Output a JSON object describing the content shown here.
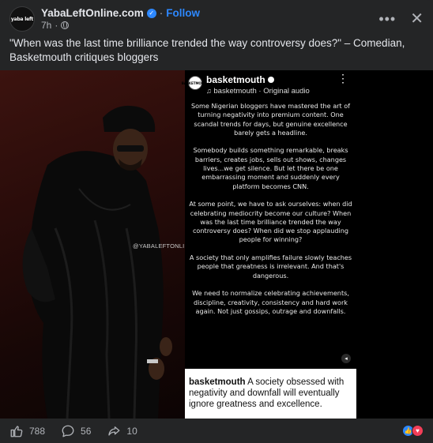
{
  "header": {
    "avatar_text": "yaba left",
    "page_name": "YabaLeftOnline.com",
    "separator": "·",
    "follow_label": "Follow",
    "time": "7h",
    "time_separator": "·"
  },
  "caption": "\"When was the last time brilliance trended the way controversy does?\" – Comedian, Basketmouth critiques bloggers",
  "media": {
    "watermark": "@YABALEFTONLINE",
    "screenshot": {
      "avatar_text": "BASKETMOUTH",
      "username": "basketmouth",
      "audio": "basketmouth · Original audio",
      "paragraphs": [
        "Some Nigerian bloggers have mastered the art of turning negativity into premium content. One scandal trends for days, but genuine excellence barely gets a headline.",
        "Somebody builds something remarkable, breaks barriers, creates jobs, sells out shows, changes lives...we get silence. But let there be one embarrassing moment and suddenly every platform becomes CNN.",
        "At some point, we have to ask ourselves: when did celebrating mediocrity become our culture? When was the last time brilliance trended the way controversy does? When did we stop applauding people for winning?",
        "A society that only amplifies failure slowly teaches people that greatness is irrelevant. And that's dangerous.",
        "We need to normalize celebrating achievements, discipline, creativity, consistency and hard work again. Not just gossips, outrage and downfalls."
      ],
      "caption_user": "basketmouth",
      "caption_text": " A society obsessed with negativity and downfall will eventually ignore greatness and excellence."
    }
  },
  "footer": {
    "likes": "788",
    "comments": "56",
    "shares": "10"
  },
  "colors": {
    "background": "#242526",
    "accent": "#2d88ff",
    "love": "#f33e58"
  }
}
